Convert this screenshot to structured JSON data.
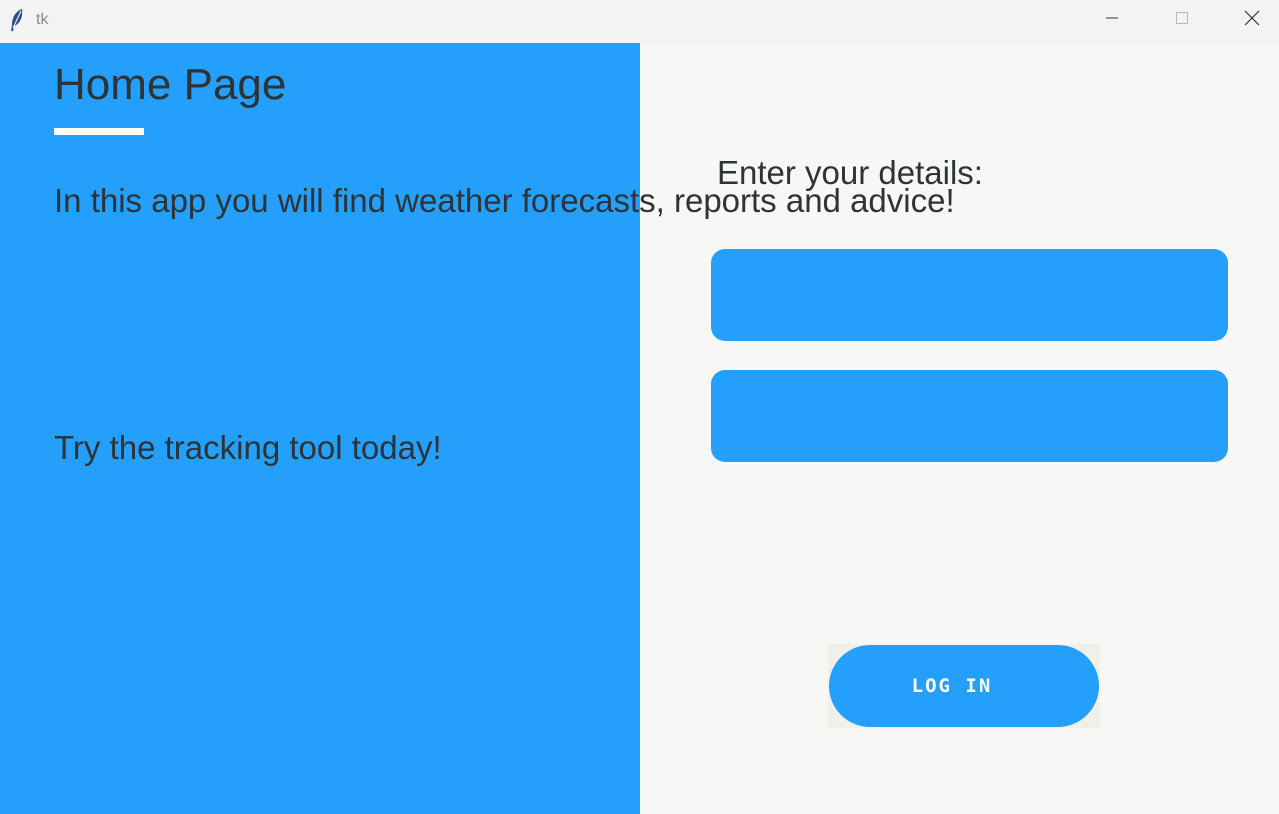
{
  "window": {
    "title": "tk",
    "controls": {
      "minimize_icon": "minimize-icon",
      "maximize_icon": "maximize-icon",
      "close_icon": "close-icon"
    }
  },
  "home": {
    "title": "Home Page",
    "intro": "In this app you will find weather forecasts, reports and advice!",
    "tracking": "Try the tracking tool today!"
  },
  "login_form": {
    "heading": "Enter your details:",
    "username_value": "",
    "password_value": "",
    "login_label": "LOG IN"
  },
  "colors": {
    "accent": "#24a0fc",
    "panel_bg": "#f7f7f5",
    "text": "#2e3338"
  }
}
